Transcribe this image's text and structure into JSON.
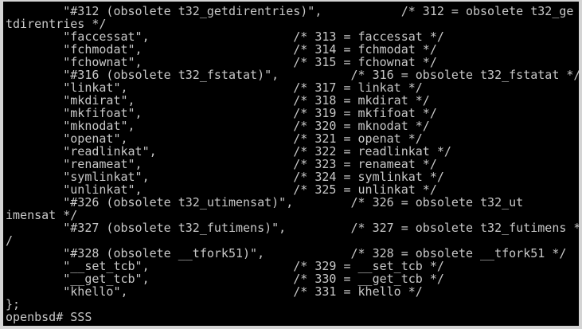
{
  "terminal": {
    "lines": [
      "        \"#312 (obsolete t32_getdirentries)\",           /* 312 = obsolete t32_ge",
      "tdirentries */",
      "        \"faccessat\",                    /* 313 = faccessat */",
      "        \"fchmodat\",                     /* 314 = fchmodat */",
      "        \"fchownat\",                     /* 315 = fchownat */",
      "        \"#316 (obsolete t32_fstatat)\",          /* 316 = obsolete t32_fstatat */",
      "        \"linkat\",                       /* 317 = linkat */",
      "        \"mkdirat\",                      /* 318 = mkdirat */",
      "        \"mkfifoat\",                     /* 319 = mkfifoat */",
      "        \"mknodat\",                      /* 320 = mknodat */",
      "        \"openat\",                       /* 321 = openat */",
      "        \"readlinkat\",                   /* 322 = readlinkat */",
      "        \"renameat\",                     /* 323 = renameat */",
      "        \"symlinkat\",                    /* 324 = symlinkat */",
      "        \"unlinkat\",                     /* 325 = unlinkat */",
      "        \"#326 (obsolete t32_utimensat)\",        /* 326 = obsolete t32_ut",
      "imensat */",
      "        \"#327 (obsolete t32_futimens)\",         /* 327 = obsolete t32_futimens *",
      "/",
      "        \"#328 (obsolete __tfork51)\",            /* 328 = obsolete __tfork51 */",
      "        \"__set_tcb\",                    /* 329 = __set_tcb */",
      "        \"__get_tcb\",                    /* 330 = __get_tcb */",
      "        \"khello\",                       /* 331 = khello */",
      "};",
      "openbsd# SSS"
    ]
  }
}
